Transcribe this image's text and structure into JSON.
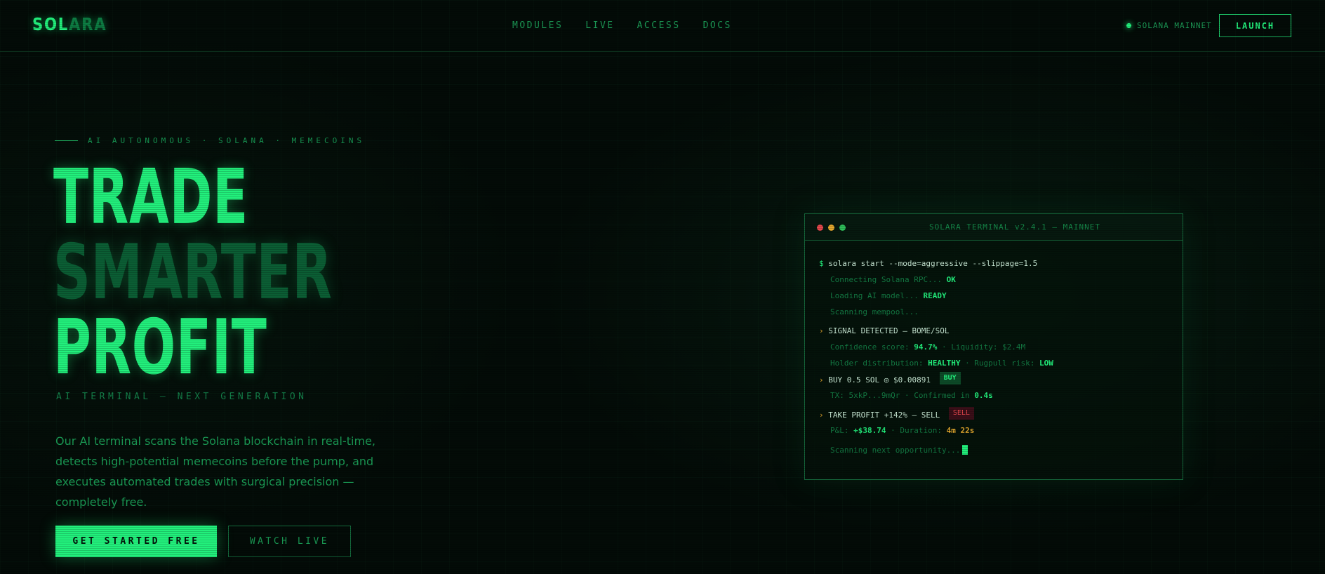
{
  "nav": {
    "logo_a": "SOL",
    "logo_b": "ARA",
    "links": [
      "MODULES",
      "LIVE",
      "ACCESS",
      "DOCS"
    ],
    "network_label": "SOLANA MAINNET",
    "launch_label": "LAUNCH"
  },
  "hero": {
    "eyebrow": "AI AUTONOMOUS · SOLANA · MEMECOINS",
    "headline": [
      "TRADE",
      "SMARTER",
      "PROFIT"
    ],
    "subhead": "AI TERMINAL — NEXT GENERATION",
    "description": "Our AI terminal scans the Solana blockchain in real-time, detects high-potential memecoins before the pump, and executes automated trades with surgical precision — completely free.",
    "cta_primary": "GET STARTED FREE",
    "cta_secondary": "WATCH LIVE"
  },
  "terminal": {
    "title": "SOLARA TERMINAL v2.4.1 — MAINNET",
    "prompt": "$",
    "command": "solara start --mode=aggressive --slippage=1.5",
    "connecting": "Connecting Solana RPC...",
    "connecting_status": "OK",
    "loading": "Loading AI model...",
    "loading_status": "READY",
    "scanning": "Scanning mempool...",
    "arrow": "›",
    "signal": "SIGNAL DETECTED — BOME/SOL",
    "confidence_label": "Confidence score:",
    "confidence_value": "94.7%",
    "liquidity_label": "· Liquidity: $2.4M",
    "holder_label": "Holder distribution:",
    "holder_value": "HEALTHY",
    "rugpull_label": "· Rugpull risk:",
    "rugpull_value": "LOW",
    "buy_line": "BUY 0.5 SOL ◎ $0.00891",
    "buy_tag": "BUY",
    "tx_label": "TX: 5xkP...9mQr · Confirmed in",
    "tx_value": "0.4s",
    "take_profit": "TAKE PROFIT +142% — SELL",
    "sell_tag": "SELL",
    "pnl_label": "P&L:",
    "pnl_value": "+$38.74",
    "duration_label": "· Duration:",
    "duration_value": "4m 22s",
    "next": "Scanning next opportunity..."
  },
  "colors": {
    "accent": "#22f07c",
    "accent_dim": "#0b5e34",
    "background": "#030b07",
    "warning": "#e5a92e",
    "danger": "#e5484d"
  }
}
